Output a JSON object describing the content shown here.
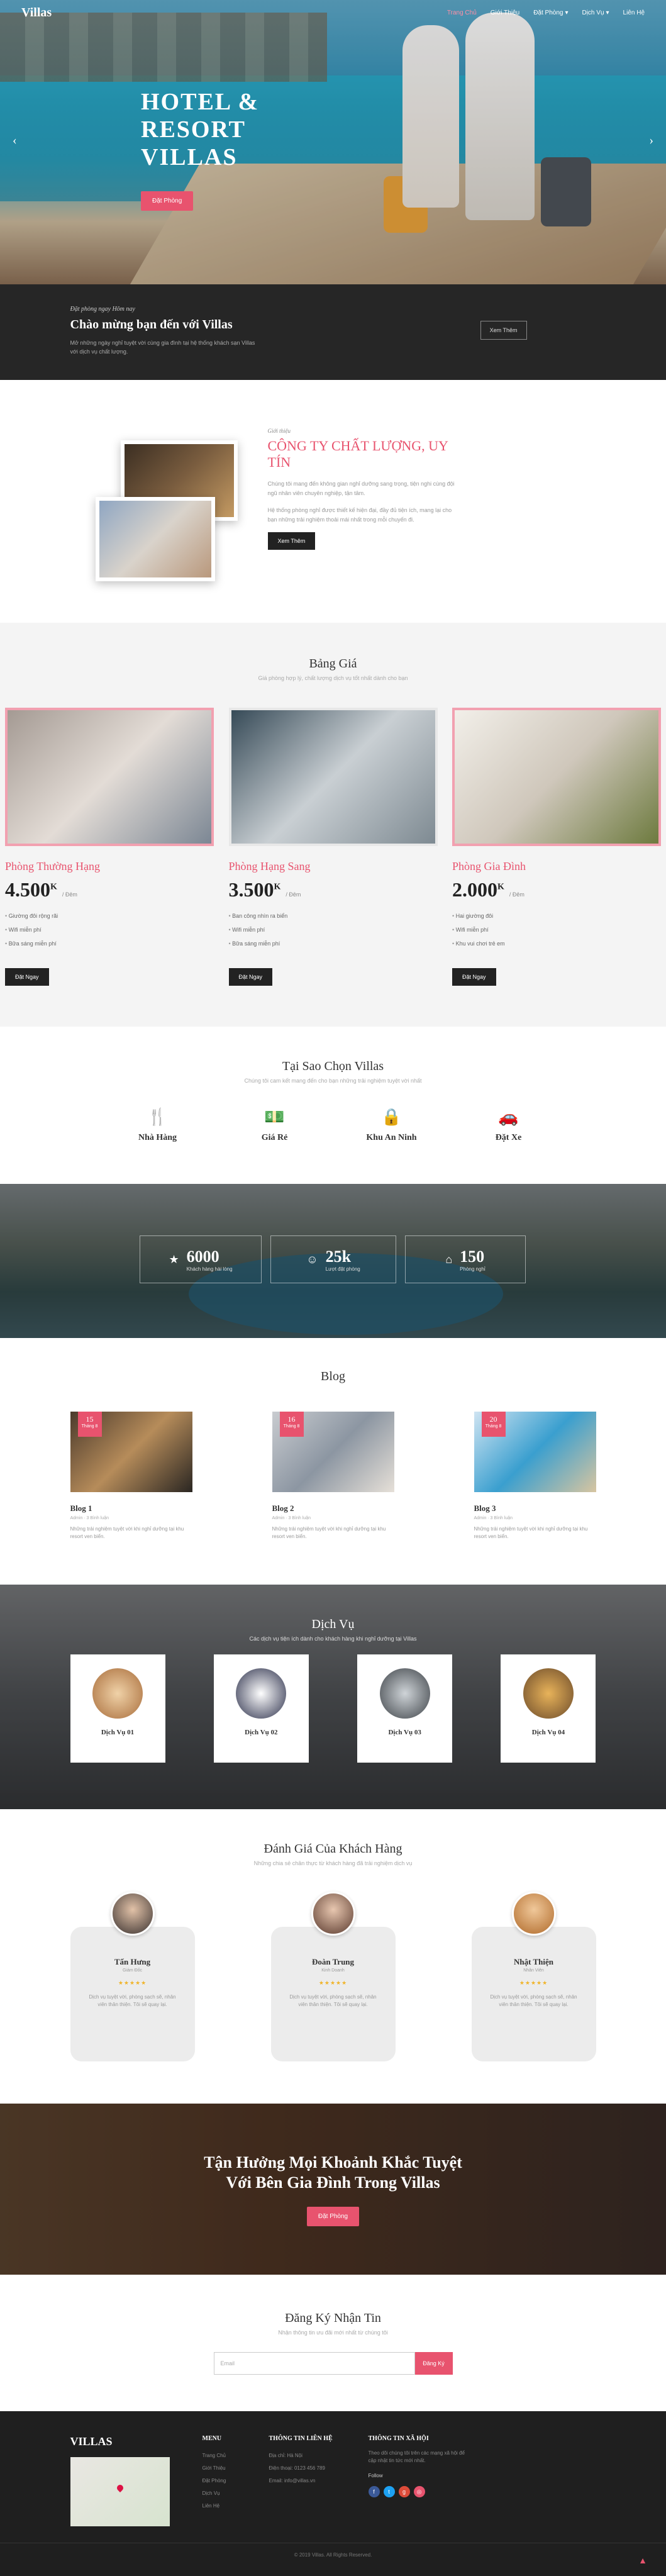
{
  "nav": {
    "brand": "Villas",
    "items": [
      "Trang Chủ",
      "Giới Thiệu",
      "Đặt Phòng",
      "Dịch Vụ",
      "Liên Hệ"
    ]
  },
  "hero": {
    "title": "HOTEL & RESORT VILLAS",
    "button": "Đặt Phòng",
    "prev": "‹",
    "next": "›"
  },
  "welcome": {
    "small": "Đặt phòng ngay Hôm nay",
    "title": "Chào mừng bạn đến với Villas",
    "text": "Mở những ngày nghỉ tuyệt vời cùng gia đình tại hệ thống khách sạn Villas với dịch vụ chất lượng.",
    "button": "Xem Thêm"
  },
  "about": {
    "small": "Giới thiệu",
    "title": "CÔNG TY CHẤT LƯỢNG, UY TÍN",
    "p1": "Chúng tôi mang đến không gian nghỉ dưỡng sang trọng, tiện nghi cùng đội ngũ nhân viên chuyên nghiệp, tận tâm.",
    "p2": "Hệ thống phòng nghỉ được thiết kế hiện đại, đầy đủ tiện ích, mang lại cho bạn những trải nghiệm thoải mái nhất trong mỗi chuyến đi.",
    "button": "Xem Thêm"
  },
  "pricing": {
    "title": "Bảng Giá",
    "subtitle": "Giá phòng hợp lý, chất lượng dịch vụ tốt nhất dành cho bạn",
    "rooms": [
      {
        "name": "Phòng Thường Hạng",
        "price": "4.500",
        "unit": "K",
        "per": "/ Đêm",
        "features": [
          "Giường đôi rộng rãi",
          "Wifi miễn phí",
          "Bữa sáng miễn phí"
        ],
        "button": "Đặt Ngay"
      },
      {
        "name": "Phòng Hạng Sang",
        "price": "3.500",
        "unit": "K",
        "per": "/ Đêm",
        "features": [
          "Ban công nhìn ra biển",
          "Wifi miễn phí",
          "Bữa sáng miễn phí"
        ],
        "button": "Đặt Ngay"
      },
      {
        "name": "Phòng Gia Đình",
        "price": "2.000",
        "unit": "K",
        "per": "/ Đêm",
        "features": [
          "Hai giường đôi",
          "Wifi miễn phí",
          "Khu vui chơi trẻ em"
        ],
        "button": "Đặt Ngay"
      }
    ]
  },
  "why": {
    "title": "Tại Sao Chọn Villas",
    "subtitle": "Chúng tôi cam kết mang đến cho bạn những trải nghiệm tuyệt vời nhất",
    "items": [
      "Nhà Hàng",
      "Giá Rẻ",
      "Khu An Ninh",
      "Đặt Xe"
    ]
  },
  "stats": [
    {
      "n": "6000",
      "l": "Khách hàng hài lòng"
    },
    {
      "n": "25k",
      "l": "Lượt đặt phòng"
    },
    {
      "n": "150",
      "l": "Phòng nghỉ"
    }
  ],
  "blog": {
    "title": "Blog",
    "posts": [
      {
        "day": "15",
        "mon": "Tháng 8",
        "title": "Blog 1",
        "meta": "Admin · 3 Bình luận",
        "text": "Những trải nghiệm tuyệt vời khi nghỉ dưỡng tại khu resort ven biển."
      },
      {
        "day": "16",
        "mon": "Tháng 8",
        "title": "Blog 2",
        "meta": "Admin · 3 Bình luận",
        "text": "Những trải nghiệm tuyệt vời khi nghỉ dưỡng tại khu resort ven biển."
      },
      {
        "day": "20",
        "mon": "Tháng 8",
        "title": "Blog 3",
        "meta": "Admin · 3 Bình luận",
        "text": "Những trải nghiệm tuyệt vời khi nghỉ dưỡng tại khu resort ven biển."
      }
    ]
  },
  "services": {
    "title": "Dịch Vụ",
    "subtitle": "Các dịch vụ tiện ích dành cho khách hàng khi nghỉ dưỡng tại Villas",
    "items": [
      "Dịch Vụ 01",
      "Dịch Vụ 02",
      "Dịch Vụ 03",
      "Dịch Vụ 04"
    ]
  },
  "reviews": {
    "title": "Đánh Giá Của Khách Hàng",
    "subtitle": "Những chia sẻ chân thực từ khách hàng đã trải nghiệm dịch vụ",
    "items": [
      {
        "name": "Tấn Hưng",
        "role": "Giám Đốc",
        "stars": "★★★★★",
        "text": "Dịch vụ tuyệt vời, phòng sạch sẽ, nhân viên thân thiện. Tôi sẽ quay lại."
      },
      {
        "name": "Đoàn Trung",
        "role": "Kinh Doanh",
        "stars": "★★★★★",
        "text": "Dịch vụ tuyệt vời, phòng sạch sẽ, nhân viên thân thiện. Tôi sẽ quay lại."
      },
      {
        "name": "Nhật Thiện",
        "role": "Nhân Viên",
        "stars": "★★★★★",
        "text": "Dịch vụ tuyệt vời, phòng sạch sẽ, nhân viên thân thiện. Tôi sẽ quay lại."
      }
    ]
  },
  "cta": {
    "line1": "Tận Hưởng Mọi Khoảnh Khắc Tuyệt",
    "line2": "Với Bên Gia Đình Trong Villas",
    "button": "Đặt Phòng"
  },
  "newsletter": {
    "title": "Đăng Ký Nhận Tin",
    "subtitle": "Nhận thông tin ưu đãi mới nhất từ chúng tôi",
    "placeholder": "Email",
    "button": "Đăng Ký"
  },
  "footer": {
    "brand": "VILLAS",
    "menu_title": "MENU",
    "menu": [
      "Trang Chủ",
      "Giới Thiệu",
      "Đặt Phòng",
      "Dịch Vụ",
      "Liên Hệ"
    ],
    "contact_title": "THÔNG TIN LIÊN HỆ",
    "contact": [
      "Địa chỉ: Hà Nội",
      "Điện thoại: 0123 456 789",
      "Email: info@villas.vn"
    ],
    "social_title": "THÔNG TIN XÃ HỘI",
    "social_text": "Theo dõi chúng tôi trên các mạng xã hội để cập nhật tin tức mới nhất.",
    "follow": "Follow",
    "copy": "© 2019 Villas. All Rights Reserved."
  }
}
